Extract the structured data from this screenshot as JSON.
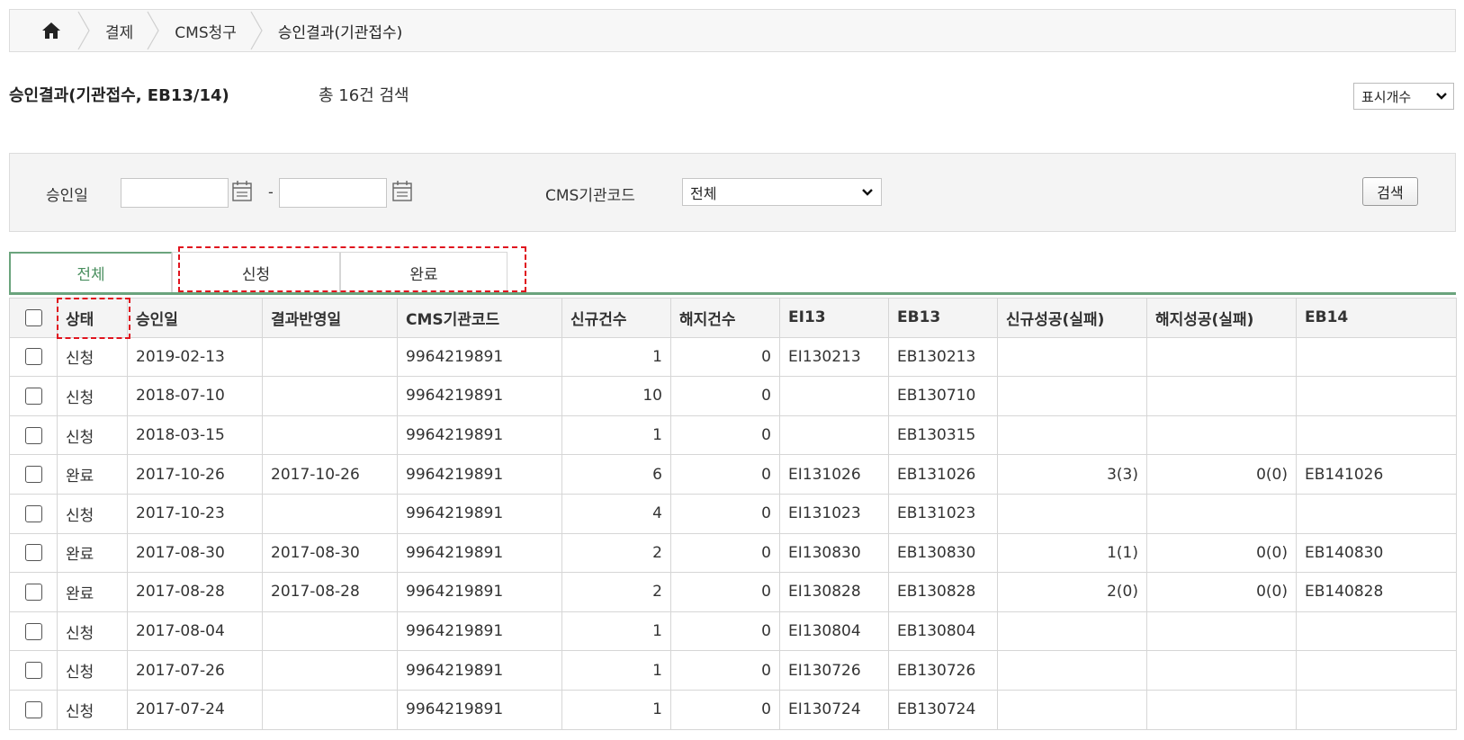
{
  "breadcrumb": {
    "home_icon": "home-icon",
    "items": [
      "결제",
      "CMS청구",
      "승인결과(기관접수)"
    ]
  },
  "header": {
    "title": "승인결과(기관접수, EB13/14)",
    "total": "총 16건 검색",
    "display_count": "표시개수"
  },
  "filter": {
    "approval_date_label": "승인일",
    "date_from": "",
    "date_to": "",
    "date_separator": "-",
    "org_code_label": "CMS기관코드",
    "org_code_value": "전체",
    "search_label": "검색"
  },
  "tabs": [
    "전체",
    "신청",
    "완료"
  ],
  "active_tab": 0,
  "colors": {
    "accent": "#6ba47d",
    "active_tab_text": "#4a8f5f",
    "highlight": "#e0141e"
  },
  "table": {
    "columns": [
      "상태",
      "승인일",
      "결과반영일",
      "CMS기관코드",
      "신규건수",
      "해지건수",
      "EI13",
      "EB13",
      "신규성공(실패)",
      "해지성공(실패)",
      "EB14"
    ],
    "rows": [
      [
        "신청",
        "2019-02-13",
        "",
        "9964219891",
        "1",
        "0",
        "EI130213",
        "EB130213",
        "",
        "",
        ""
      ],
      [
        "신청",
        "2018-07-10",
        "",
        "9964219891",
        "10",
        "0",
        "",
        "EB130710",
        "",
        "",
        ""
      ],
      [
        "신청",
        "2018-03-15",
        "",
        "9964219891",
        "1",
        "0",
        "",
        "EB130315",
        "",
        "",
        ""
      ],
      [
        "완료",
        "2017-10-26",
        "2017-10-26",
        "9964219891",
        "6",
        "0",
        "EI131026",
        "EB131026",
        "3(3)",
        "0(0)",
        "EB141026"
      ],
      [
        "신청",
        "2017-10-23",
        "",
        "9964219891",
        "4",
        "0",
        "EI131023",
        "EB131023",
        "",
        "",
        ""
      ],
      [
        "완료",
        "2017-08-30",
        "2017-08-30",
        "9964219891",
        "2",
        "0",
        "EI130830",
        "EB130830",
        "1(1)",
        "0(0)",
        "EB140830"
      ],
      [
        "완료",
        "2017-08-28",
        "2017-08-28",
        "9964219891",
        "2",
        "0",
        "EI130828",
        "EB130828",
        "2(0)",
        "0(0)",
        "EB140828"
      ],
      [
        "신청",
        "2017-08-04",
        "",
        "9964219891",
        "1",
        "0",
        "EI130804",
        "EB130804",
        "",
        "",
        ""
      ],
      [
        "신청",
        "2017-07-26",
        "",
        "9964219891",
        "1",
        "0",
        "EI130726",
        "EB130726",
        "",
        "",
        ""
      ],
      [
        "신청",
        "2017-07-24",
        "",
        "9964219891",
        "1",
        "0",
        "EI130724",
        "EB130724",
        "",
        "",
        ""
      ]
    ]
  }
}
